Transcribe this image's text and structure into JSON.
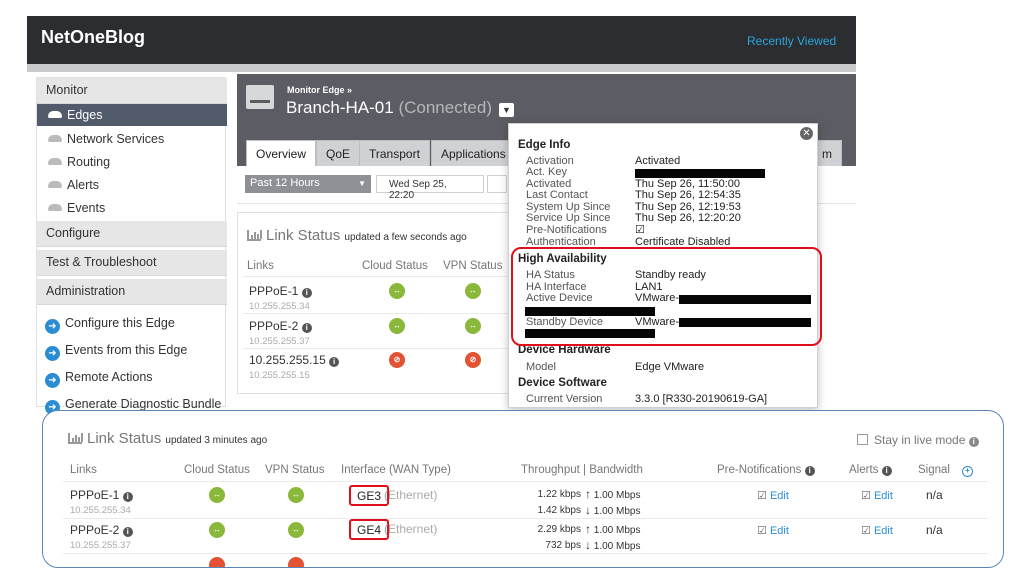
{
  "header": {
    "brand": "NetOneBlog",
    "recently_viewed": "Recently Viewed"
  },
  "sidebar": {
    "monitor": "Monitor",
    "monitor_items": [
      "Edges",
      "Network Services",
      "Routing",
      "Alerts",
      "Events"
    ],
    "configure": "Configure",
    "test": "Test & Troubleshoot",
    "admin": "Administration",
    "actions": [
      "Configure this Edge",
      "Events from this Edge",
      "Remote Actions",
      "Generate Diagnostic Bundle"
    ]
  },
  "edge": {
    "breadcrumb": "Monitor Edge »",
    "name": "Branch-HA-01",
    "state": "(Connected)",
    "tabs": [
      "Overview",
      "QoE",
      "Transport",
      "Applications",
      "m"
    ],
    "period": "Past 12 Hours",
    "start_date": "Wed Sep 25, 22:20"
  },
  "link_status_small": {
    "title": "Link Status",
    "updated": "updated a few seconds ago",
    "cols": [
      "Links",
      "Cloud Status",
      "VPN Status"
    ],
    "rows": [
      {
        "name": "PPPoE-1",
        "ip": "10.255.255.34"
      },
      {
        "name": "PPPoE-2",
        "ip": "10.255.255.37"
      },
      {
        "name": "10.255.255.15",
        "ip": "10.255.255.15"
      }
    ]
  },
  "popup": {
    "edge_info_title": "Edge Info",
    "edge_info": [
      {
        "k": "Activation",
        "v": "Activated"
      },
      {
        "k": "Act. Key",
        "v": ""
      },
      {
        "k": "Activated",
        "v": "Thu Sep 26, 11:50:00"
      },
      {
        "k": "Last Contact",
        "v": "Thu Sep 26, 12:54:35"
      },
      {
        "k": "System Up Since",
        "v": "Thu Sep 26, 12:19:53"
      },
      {
        "k": "Service Up Since",
        "v": "Thu Sep 26, 12:20:20"
      },
      {
        "k": "Pre-Notifications",
        "v": "☑"
      },
      {
        "k": "Authentication",
        "v": "Certificate Disabled"
      }
    ],
    "ha_title": "High Availability",
    "ha": [
      {
        "k": "HA Status",
        "v": "Standby ready"
      },
      {
        "k": "HA Interface",
        "v": "LAN1"
      },
      {
        "k": "Active Device",
        "v": "VMware-"
      },
      {
        "k": "Standby Device",
        "v": "VMware-"
      }
    ],
    "hw_title": "Device Hardware",
    "hw": [
      {
        "k": "Model",
        "v": "Edge VMware"
      }
    ],
    "sw_title": "Device Software",
    "sw": [
      {
        "k": "Current Version",
        "v": "3.3.0 [R330-20190619-GA]"
      }
    ]
  },
  "link_status_large": {
    "title": "Link Status",
    "updated": "updated 3 minutes ago",
    "live_mode": "Stay in live mode",
    "cols": {
      "links": "Links",
      "cloud": "Cloud Status",
      "vpn": "VPN Status",
      "iface": "Interface (WAN Type)",
      "throughput": "Throughput | Bandwidth",
      "prenotif": "Pre-Notifications",
      "alerts": "Alerts",
      "signal": "Signal"
    },
    "rows": [
      {
        "name": "PPPoE-1",
        "ip": "10.255.255.34",
        "iface": "GE3",
        "type": "(Ethernet)",
        "up": "1.22 kbps",
        "down": "1.42 kbps",
        "bw_up": "1.00 Mbps",
        "bw_down": "1.00 Mbps",
        "edit1": "Edit",
        "edit2": "Edit",
        "signal": "n/a"
      },
      {
        "name": "PPPoE-2",
        "ip": "10.255.255.37",
        "iface": "GE4",
        "type": "(Ethernet)",
        "up": "2.29 kbps",
        "down": "732 bps",
        "bw_up": "1.00 Mbps",
        "bw_down": "1.00 Mbps",
        "edit1": "Edit",
        "edit2": "Edit",
        "signal": "n/a"
      }
    ]
  },
  "colors": {
    "accent": "#2a8dd4",
    "highlight": "#e0101b",
    "ok": "#8ab83a",
    "down": "#e35233"
  }
}
